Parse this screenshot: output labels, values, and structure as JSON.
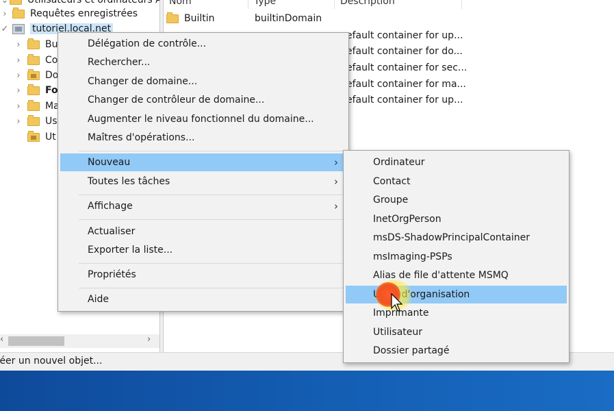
{
  "tree": {
    "top_label": "Utilisateurs et ordinateurs Active Directory",
    "saved_queries": "Requêtes enregistrées",
    "domain": "tutoriel.local.net",
    "children": [
      "Bu",
      "Co",
      "Do",
      "Fo",
      "Ma",
      "Us",
      "Ut"
    ]
  },
  "list": {
    "columns": [
      "Nom",
      "Type",
      "Description"
    ],
    "rows": [
      {
        "name": "Builtin",
        "type": "builtinDomain",
        "description": ""
      },
      {
        "description": "efault container for up..."
      },
      {
        "description": "efault container for do..."
      },
      {
        "description": "efault container for sec..."
      },
      {
        "description": "efault container for ma..."
      },
      {
        "description": "efault container for up..."
      }
    ]
  },
  "status": "réer un nouvel objet...",
  "context_menu": {
    "items": [
      "Délégation de contrôle...",
      "Rechercher...",
      "Changer de domaine...",
      "Changer de contrôleur de domaine...",
      "Augmenter le niveau fonctionnel du domaine...",
      "Maîtres d'opérations...",
      "Nouveau",
      "Toutes les tâches",
      "Affichage",
      "Actualiser",
      "Exporter la liste...",
      "Propriétés",
      "Aide"
    ],
    "selected": "Nouveau"
  },
  "submenu": {
    "items": [
      "Ordinateur",
      "Contact",
      "Groupe",
      "InetOrgPerson",
      "msDS-ShadowPrincipalContainer",
      "msImaging-PSPs",
      "Alias de file d'attente MSMQ",
      "Unité d'organisation",
      "Imprimante",
      "Utilisateur",
      "Dossier partagé"
    ],
    "selected": "Unité d'organisation"
  },
  "colors": {
    "selection": "#91c9f7",
    "menu_bg": "#f2f2f2",
    "taskbar": "#1460b6",
    "folder": "#f1c65a"
  }
}
